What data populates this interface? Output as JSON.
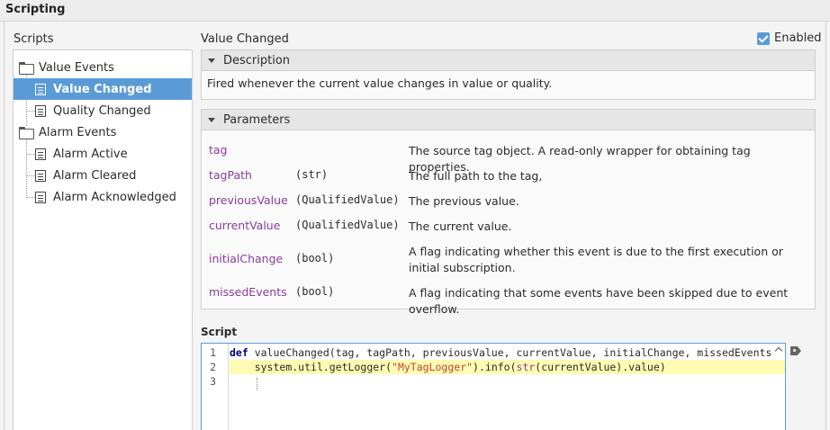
{
  "window": {
    "title": "Scripting"
  },
  "scripts_panel": {
    "label": "Scripts",
    "tree": [
      {
        "label": "Value Events",
        "type": "folder",
        "level": 0
      },
      {
        "label": "Value Changed",
        "type": "script",
        "level": 1,
        "selected": true
      },
      {
        "label": "Quality Changed",
        "type": "script",
        "level": 1
      },
      {
        "label": "Alarm Events",
        "type": "folder",
        "level": 0
      },
      {
        "label": "Alarm Active",
        "type": "script",
        "level": 1
      },
      {
        "label": "Alarm Cleared",
        "type": "script",
        "level": 1
      },
      {
        "label": "Alarm Acknowledged",
        "type": "script",
        "level": 1
      }
    ]
  },
  "detail": {
    "title": "Value Changed",
    "enabled_label": "Enabled",
    "enabled": true,
    "description": {
      "header": "Description",
      "text": "Fired whenever the current value changes in value or quality."
    },
    "parameters": {
      "header": "Parameters",
      "rows": [
        {
          "name": "tag",
          "type": "",
          "desc": "The source tag object. A read-only wrapper for obtaining tag properties."
        },
        {
          "name": "tagPath",
          "type": "(str)",
          "desc": "The full path to the tag,"
        },
        {
          "name": "previousValue",
          "type": "(QualifiedValue)",
          "desc": "The previous value."
        },
        {
          "name": "currentValue",
          "type": "(QualifiedValue)",
          "desc": "The current value."
        },
        {
          "name": "initialChange",
          "type": "(bool)",
          "desc": "A flag indicating whether this event is due to the first execution or initial subscription."
        },
        {
          "name": "missedEvents",
          "type": "(bool)",
          "desc": "A flag indicating that some events have been skipped due to event overflow."
        }
      ]
    },
    "script": {
      "label": "Script",
      "line_numbers": [
        "1",
        "2",
        "3"
      ],
      "line1": {
        "kw": "def",
        "rest": " valueChanged(tag, tagPath, previousValue, currentValue, initialChange, missedEvents"
      },
      "line2": {
        "indent": "    ",
        "pre": "system.util.getLogger(",
        "str": "\"MyTagLogger\"",
        "mid": ").info(",
        "builtin": "str",
        "post": "(currentValue).value)"
      }
    }
  },
  "colors": {
    "accent": "#5b9bd5",
    "param_name": "#8a3c9e",
    "highlight": "#fffbb3"
  },
  "icons": [
    "folder-icon",
    "script-icon",
    "checkbox-icon",
    "collapse-triangle-icon",
    "tag-icon",
    "chevron-up-icon"
  ]
}
